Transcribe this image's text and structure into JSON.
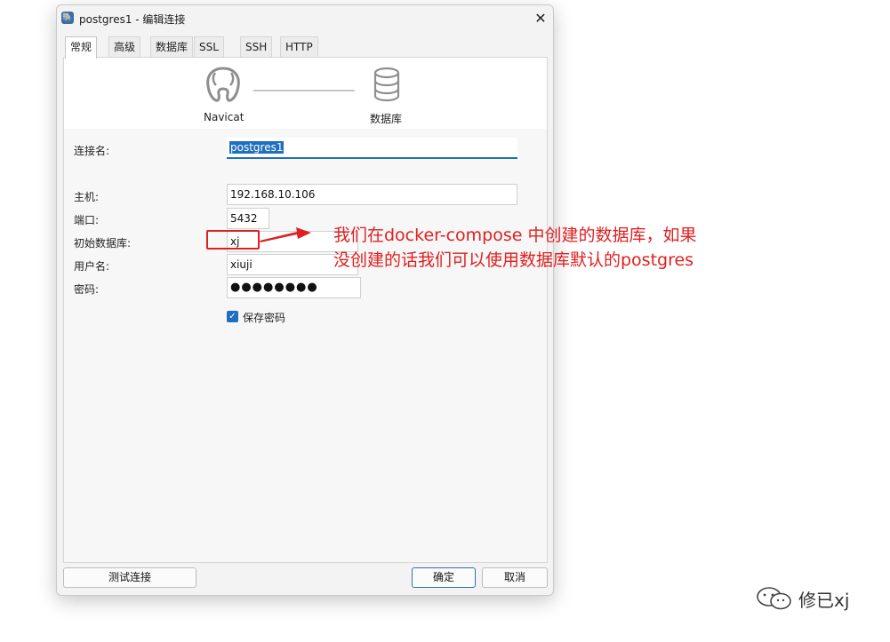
{
  "window": {
    "title": "postgres1 - 编辑连接",
    "app_icon": "elephant-icon"
  },
  "tabs": [
    {
      "label": "常规",
      "active": true
    },
    {
      "label": "高级"
    },
    {
      "label": "数据库"
    },
    {
      "label": "SSL"
    },
    {
      "label": "SSH"
    },
    {
      "label": "HTTP"
    }
  ],
  "hero": {
    "left_label": "Navicat",
    "right_label": "数据库"
  },
  "form": {
    "connection_name": {
      "label": "连接名:",
      "value": "postgres1"
    },
    "host": {
      "label": "主机:",
      "value": "192.168.10.106"
    },
    "port": {
      "label": "端口:",
      "value": "5432"
    },
    "initial_db": {
      "label": "初始数据库:",
      "value": "xj"
    },
    "username": {
      "label": "用户名:",
      "value": "xiuji"
    },
    "password": {
      "label": "密码:",
      "value": "●●●●●●●●"
    },
    "save_password": {
      "label": "保存密码",
      "checked": true
    }
  },
  "buttons": {
    "test": "测试连接",
    "ok": "确定",
    "cancel": "取消"
  },
  "annotation": {
    "line1": "我们在docker-compose 中创建的数据库，如果",
    "line2": "没创建的话我们可以使用数据库默认的postgres",
    "color": "#e02020"
  },
  "watermark": {
    "text": "修已xj"
  },
  "colors": {
    "accent": "#1e6fbf"
  }
}
